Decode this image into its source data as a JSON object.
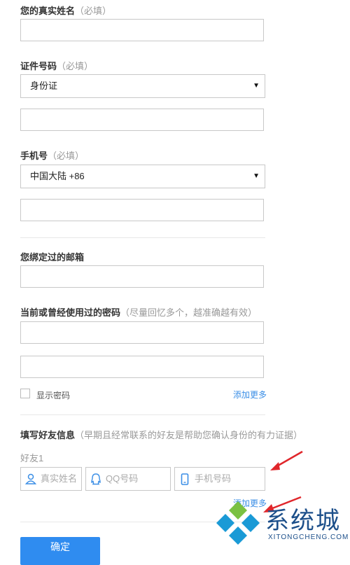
{
  "name_section": {
    "label": "您的真实姓名",
    "hint": "（必填）"
  },
  "id_section": {
    "label": "证件号码",
    "hint": "（必填）",
    "select_value": "身份证"
  },
  "phone_section": {
    "label": "手机号",
    "hint": "（必填）",
    "select_value": "中国大陆 +86"
  },
  "email_section": {
    "label": "您绑定过的邮箱"
  },
  "password_section": {
    "label": "当前或曾经使用过的密码",
    "hint": "（尽量回忆多个，越准确越有效）",
    "show_password_label": "显示密码",
    "add_more": "添加更多"
  },
  "friend_section": {
    "label": "填写好友信息",
    "hint": "（早期且经常联系的好友是帮助您确认身份的有力证据）",
    "friend_title": "好友1",
    "name_placeholder": "真实姓名",
    "qq_placeholder": "QQ号码",
    "phone_placeholder": "手机号码",
    "add_more": "添加更多"
  },
  "confirm_button": "确定",
  "watermark": {
    "brand": "系统城",
    "sub": "XITONGCHENG.COM"
  },
  "colors": {
    "link": "#3a8ee6",
    "button": "#2f8cf0",
    "arrow": "#e0262b",
    "logo": "#1c4f8a"
  }
}
